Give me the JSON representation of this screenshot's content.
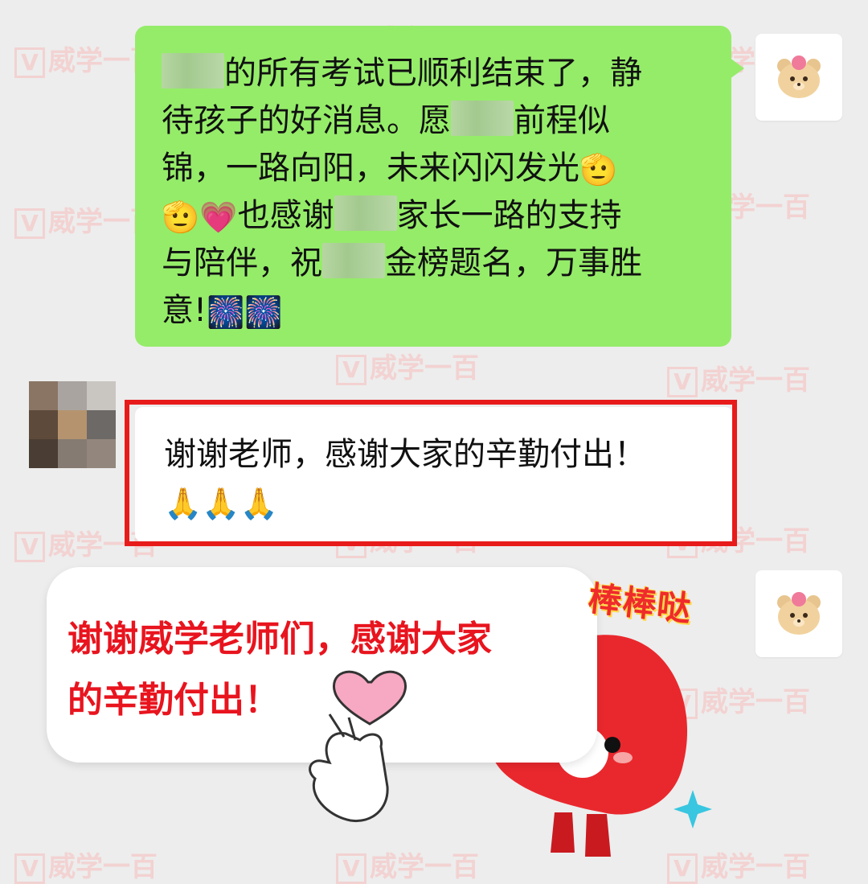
{
  "watermark": {
    "logo_letter": "V",
    "text": "威学一百"
  },
  "green_message": {
    "lines": [
      [
        "",
        "的所有考试已顺利结束了，静"
      ],
      [
        "待孩子的好消息。愿",
        "",
        "前程似"
      ],
      [
        "锦，一路向阳，未来闪闪发光",
        "🫡"
      ],
      [
        "🫡",
        "💗",
        "也感谢",
        "",
        "家长一路的支持"
      ],
      [
        "与陪伴，祝",
        "",
        "金榜题名，万事胜"
      ],
      [
        "意!",
        "🎆",
        "🎆"
      ]
    ]
  },
  "white_message": {
    "line1": "谢谢老师，感谢大家的辛勤付出！",
    "emojis": [
      "🙏",
      "🙏",
      "🙏"
    ]
  },
  "callout": {
    "line1": "谢谢威学老师们，感谢大家",
    "line2": "的辛勤付出！",
    "text_color": "#e8141e"
  },
  "sticker": {
    "caption": "棒棒哒"
  },
  "colors": {
    "background": "#ededed",
    "green_bubble": "#95ec69",
    "highlight_border": "#e81b1b"
  }
}
